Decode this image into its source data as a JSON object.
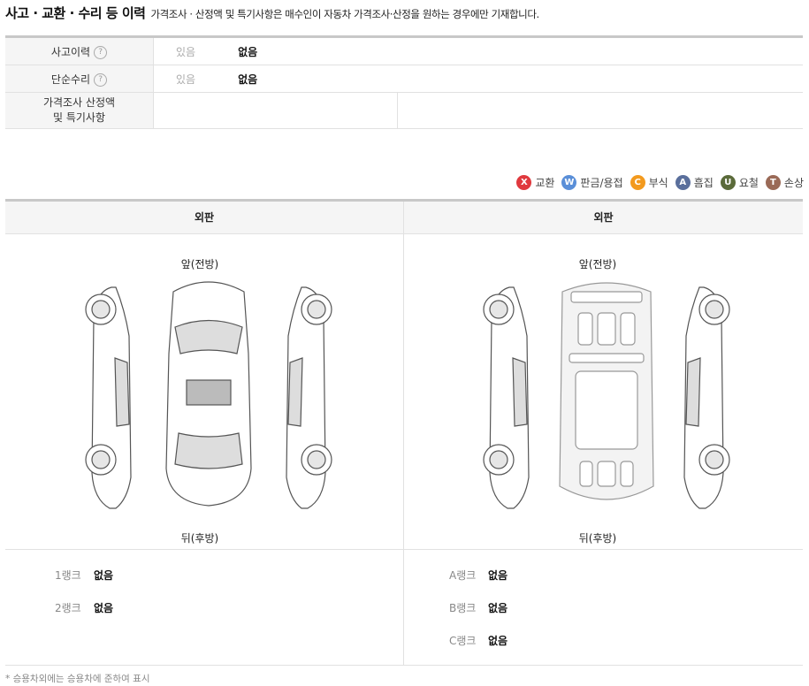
{
  "title": {
    "main": "사고 · 교환 · 수리 등 이력",
    "desc": "가격조사 · 산정액 및 특기사항은 매수인이 자동차 가격조사·산정을 원하는 경우에만 기재합니다."
  },
  "history": [
    {
      "label": "사고이력",
      "help": "?",
      "option_yes": "있음",
      "option_no": "없음"
    },
    {
      "label": "단순수리",
      "help": "?",
      "option_yes": "있음",
      "option_no": "없음"
    }
  ],
  "price_row": {
    "label_line1": "가격조사 산정액",
    "label_line2": "및 특기사항"
  },
  "legend": [
    {
      "code": "X",
      "label": "교환",
      "color": "#e0393e"
    },
    {
      "code": "W",
      "label": "판금/용접",
      "color": "#5a8fd8"
    },
    {
      "code": "C",
      "label": "부식",
      "color": "#f39a1e"
    },
    {
      "code": "A",
      "label": "흠집",
      "color": "#5a6f9c"
    },
    {
      "code": "U",
      "label": "요철",
      "color": "#5b6b3a"
    },
    {
      "code": "T",
      "label": "손상",
      "color": "#9a6a57"
    }
  ],
  "panels": [
    {
      "header": "외판",
      "front": "앞(전방)",
      "rear": "뒤(후방)"
    },
    {
      "header": "외판",
      "front": "앞(전방)",
      "rear": "뒤(후방)"
    }
  ],
  "ranks_left": [
    {
      "label": "1랭크",
      "value": "없음"
    },
    {
      "label": "2랭크",
      "value": "없음"
    }
  ],
  "ranks_right": [
    {
      "label": "A랭크",
      "value": "없음"
    },
    {
      "label": "B랭크",
      "value": "없음"
    },
    {
      "label": "C랭크",
      "value": "없음"
    }
  ],
  "footnote": "* 승용차외에는 승용차에 준하여 표시"
}
